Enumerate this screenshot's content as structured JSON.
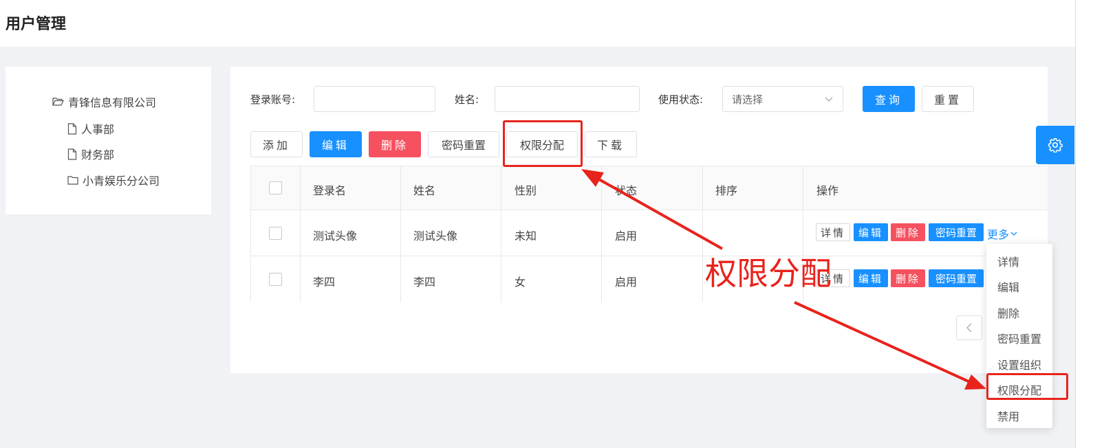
{
  "page": {
    "title": "用户管理"
  },
  "tree": {
    "root": "青锋信息有限公司",
    "children": [
      "人事部",
      "财务部",
      "小青娱乐分公司"
    ]
  },
  "search": {
    "account_label": "登录账号:",
    "name_label": "姓名:",
    "status_label": "使用状态:",
    "status_placeholder": "请选择",
    "query_button": "查询",
    "reset_button": "重置"
  },
  "toolbar": {
    "add": "添加",
    "edit": "编辑",
    "delete": "删除",
    "password_reset": "密码重置",
    "permission_assign": "权限分配",
    "download": "下载"
  },
  "table": {
    "headers": [
      "登录名",
      "姓名",
      "性别",
      "状态",
      "排序",
      "操作"
    ],
    "rows": [
      {
        "login": "测试头像",
        "name": "测试头像",
        "gender": "未知",
        "status": "启用",
        "order": ""
      },
      {
        "login": "李四",
        "name": "李四",
        "gender": "女",
        "status": "启用",
        "order": ""
      }
    ],
    "row_actions": {
      "detail": "详情",
      "edit": "编辑",
      "delete": "删除",
      "password_reset": "密码重置",
      "more": "更多"
    }
  },
  "dropdown": {
    "items": [
      "详情",
      "编辑",
      "删除",
      "密码重置",
      "设置组织",
      "权限分配",
      "禁用"
    ]
  },
  "annotation": {
    "text": "权限分配",
    "color": "#e8231c"
  },
  "colors": {
    "primary": "#1890ff",
    "danger": "#f5515f"
  }
}
